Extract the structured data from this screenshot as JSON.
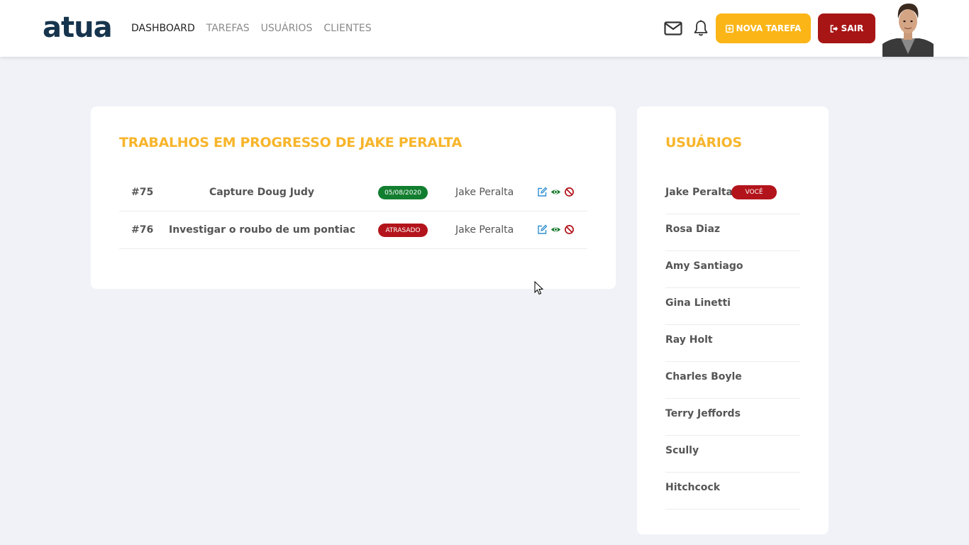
{
  "brand": {
    "logo": "atua"
  },
  "nav": {
    "links": [
      {
        "label": "DASHBOARD",
        "active": true
      },
      {
        "label": "TAREFAS",
        "active": false
      },
      {
        "label": "USUÁRIOS",
        "active": false
      },
      {
        "label": "CLIENTES",
        "active": false
      }
    ]
  },
  "header": {
    "icons": [
      "envelope-icon",
      "bell-icon"
    ],
    "new_task_label": "NOVA TAREFA",
    "exit_label": "SAIR"
  },
  "tasks_panel": {
    "title": "TRABALHOS EM PROGRESSO DE JAKE PERALTA",
    "rows": [
      {
        "id": "#75",
        "title": "Capture Doug Judy",
        "status": "05/08/2020",
        "status_color": "#127e2f",
        "assignee": "Jake Peralta"
      },
      {
        "id": "#76",
        "title": "Investigar o roubo de um pontiac",
        "status": "ATRASADO",
        "status_color": "#b3141b",
        "assignee": "Jake Peralta"
      }
    ],
    "action_icons": [
      "edit-icon",
      "view-icon",
      "cancel-icon"
    ]
  },
  "users_panel": {
    "title": "USUÁRIOS",
    "you_badge": "VOCÊ",
    "users": [
      "Jake Peralta",
      "Rosa Diaz",
      "Amy Santiago",
      "Gina Linetti",
      "Ray Holt",
      "Charles Boyle",
      "Terry Jeffords",
      "Scully",
      "Hitchcock"
    ]
  },
  "colors": {
    "accent": "#f7b52b",
    "new_task_button": "#fbb516",
    "exit_button": "#a81515",
    "logo": "#16344d",
    "background": "#f1f2f7"
  }
}
